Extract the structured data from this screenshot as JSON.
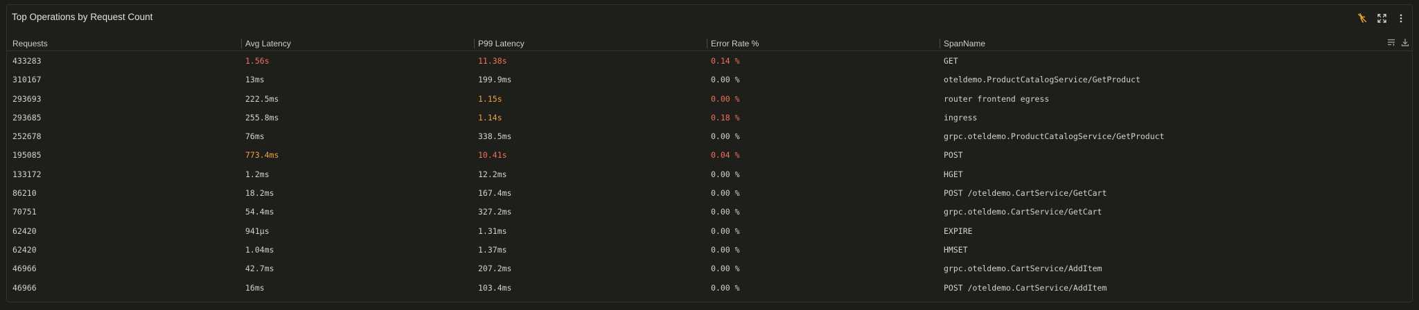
{
  "panel": {
    "title": "Top Operations by Request Count"
  },
  "icons": {
    "header": [
      "no-sync-icon",
      "expand-icon",
      "more-vertical-icon"
    ],
    "table": [
      "column-settings-icon",
      "download-icon"
    ]
  },
  "colors": {
    "background": "#1e1e1b",
    "text": "#d2d2cc",
    "red": "#f0705a",
    "orange": "#f0a040",
    "accent_icon": "#e8a033"
  },
  "table": {
    "columns": [
      "Requests",
      "Avg Latency",
      "P99 Latency",
      "Error Rate %",
      "SpanName"
    ],
    "rows": [
      {
        "requests": "433283",
        "avg": "1.56s",
        "avg_color": "red",
        "p99": "11.38s",
        "p99_color": "red",
        "err": "0.14 %",
        "err_color": "red",
        "span": "GET"
      },
      {
        "requests": "310167",
        "avg": "13ms",
        "avg_color": "",
        "p99": "199.9ms",
        "p99_color": "",
        "err": "0.00 %",
        "err_color": "",
        "span": "oteldemo.ProductCatalogService/GetProduct"
      },
      {
        "requests": "293693",
        "avg": "222.5ms",
        "avg_color": "",
        "p99": "1.15s",
        "p99_color": "orange",
        "err": "0.00 %",
        "err_color": "red",
        "span": "router frontend egress"
      },
      {
        "requests": "293685",
        "avg": "255.8ms",
        "avg_color": "",
        "p99": "1.14s",
        "p99_color": "orange",
        "err": "0.18 %",
        "err_color": "red",
        "span": "ingress"
      },
      {
        "requests": "252678",
        "avg": "76ms",
        "avg_color": "",
        "p99": "338.5ms",
        "p99_color": "",
        "err": "0.00 %",
        "err_color": "",
        "span": "grpc.oteldemo.ProductCatalogService/GetProduct"
      },
      {
        "requests": "195085",
        "avg": "773.4ms",
        "avg_color": "orange",
        "p99": "10.41s",
        "p99_color": "red",
        "err": "0.04 %",
        "err_color": "red",
        "span": "POST"
      },
      {
        "requests": "133172",
        "avg": "1.2ms",
        "avg_color": "",
        "p99": "12.2ms",
        "p99_color": "",
        "err": "0.00 %",
        "err_color": "",
        "span": "HGET"
      },
      {
        "requests": "86210",
        "avg": "18.2ms",
        "avg_color": "",
        "p99": "167.4ms",
        "p99_color": "",
        "err": "0.00 %",
        "err_color": "",
        "span": "POST /oteldemo.CartService/GetCart"
      },
      {
        "requests": "70751",
        "avg": "54.4ms",
        "avg_color": "",
        "p99": "327.2ms",
        "p99_color": "",
        "err": "0.00 %",
        "err_color": "",
        "span": "grpc.oteldemo.CartService/GetCart"
      },
      {
        "requests": "62420",
        "avg": "941µs",
        "avg_color": "",
        "p99": "1.31ms",
        "p99_color": "",
        "err": "0.00 %",
        "err_color": "",
        "span": "EXPIRE"
      },
      {
        "requests": "62420",
        "avg": "1.04ms",
        "avg_color": "",
        "p99": "1.37ms",
        "p99_color": "",
        "err": "0.00 %",
        "err_color": "",
        "span": "HMSET"
      },
      {
        "requests": "46966",
        "avg": "42.7ms",
        "avg_color": "",
        "p99": "207.2ms",
        "p99_color": "",
        "err": "0.00 %",
        "err_color": "",
        "span": "grpc.oteldemo.CartService/AddItem"
      },
      {
        "requests": "46966",
        "avg": "16ms",
        "avg_color": "",
        "p99": "103.4ms",
        "p99_color": "",
        "err": "0.00 %",
        "err_color": "",
        "span": "POST /oteldemo.CartService/AddItem"
      }
    ]
  }
}
